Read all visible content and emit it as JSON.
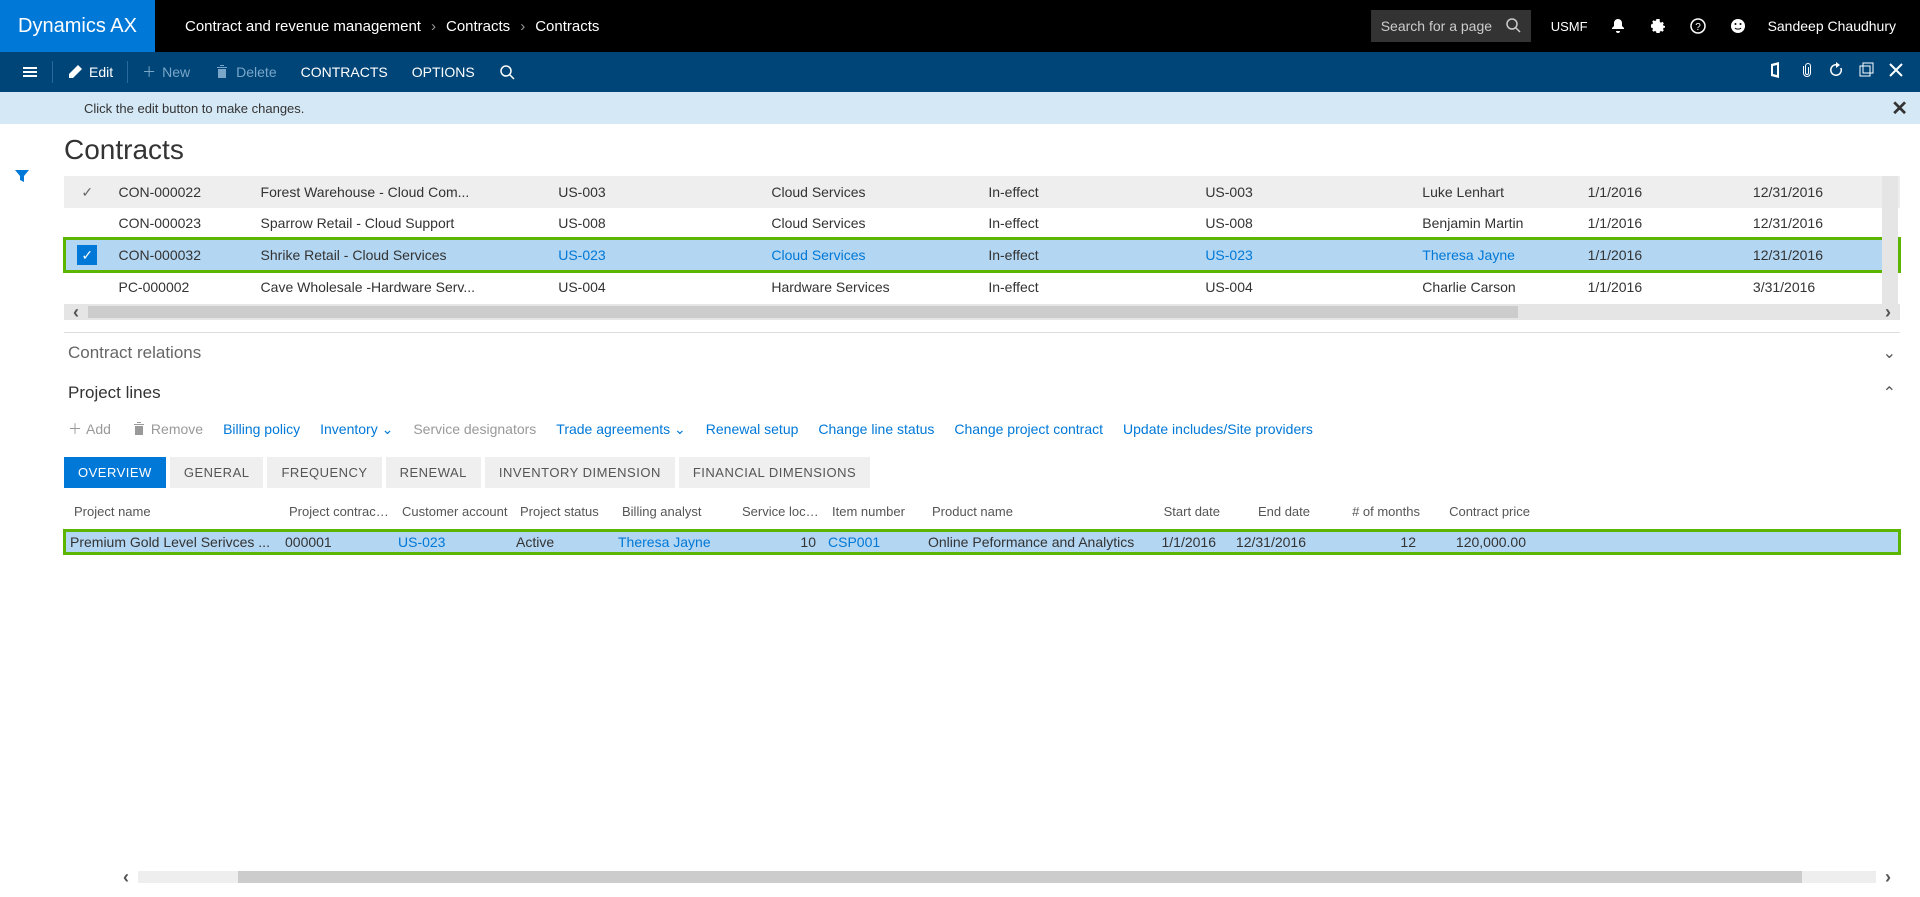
{
  "app": {
    "logo": "Dynamics AX"
  },
  "breadcrumb": [
    "Contract and revenue management",
    "Contracts",
    "Contracts"
  ],
  "search": {
    "placeholder": "Search for a page"
  },
  "company": "USMF",
  "user": "Sandeep Chaudhury",
  "toolbar": {
    "edit": "Edit",
    "new": "New",
    "delete": "Delete",
    "contracts": "CONTRACTS",
    "options": "OPTIONS"
  },
  "info": "Click the edit button to make changes.",
  "page_title": "Contracts",
  "grid": {
    "rows": [
      {
        "id": "CON-000022",
        "name": "Forest Warehouse - Cloud Com...",
        "account": "US-003",
        "service": "Cloud Services",
        "status": "In-effect",
        "loc": "US-003",
        "owner": "Luke Lenhart",
        "start": "1/1/2016",
        "end": "12/31/2016",
        "header": true
      },
      {
        "id": "CON-000023",
        "name": "Sparrow Retail - Cloud Support",
        "account": "US-008",
        "service": "Cloud Services",
        "status": "In-effect",
        "loc": "US-008",
        "owner": "Benjamin Martin",
        "start": "1/1/2016",
        "end": "12/31/2016"
      },
      {
        "id": "CON-000032",
        "name": "Shrike Retail - Cloud Services",
        "account": "US-023",
        "service": "Cloud Services",
        "status": "In-effect",
        "loc": "US-023",
        "owner": "Theresa Jayne",
        "start": "1/1/2016",
        "end": "12/31/2016",
        "selected": true,
        "highlight": true
      },
      {
        "id": "PC-000002",
        "name": "Cave Wholesale -Hardware Serv...",
        "account": "US-004",
        "service": "Hardware Services",
        "status": "In-effect",
        "loc": "US-004",
        "owner": "Charlie Carson",
        "start": "1/1/2016",
        "end": "3/31/2016"
      }
    ]
  },
  "sections": {
    "relations": "Contract relations",
    "lines": "Project lines"
  },
  "line_toolbar": {
    "add": "Add",
    "remove": "Remove",
    "billing_policy": "Billing policy",
    "inventory": "Inventory",
    "service_designators": "Service designators",
    "trade_agreements": "Trade agreements",
    "renewal_setup": "Renewal setup",
    "change_line_status": "Change line status",
    "change_project_contract": "Change project contract",
    "update_includes": "Update includes/Site providers"
  },
  "tabs": [
    "OVERVIEW",
    "GENERAL",
    "FREQUENCY",
    "RENEWAL",
    "INVENTORY DIMENSION",
    "FINANCIAL DIMENSIONS"
  ],
  "lines_cols": {
    "project_name": "Project name",
    "project_contract_id": "Project contract ID",
    "customer_account": "Customer account",
    "project_status": "Project status",
    "billing_analyst": "Billing analyst",
    "service_location": "Service locati...",
    "item_number": "Item number",
    "product_name": "Product name",
    "start_date": "Start date",
    "end_date": "End date",
    "months": "# of months",
    "contract_price": "Contract price"
  },
  "lines_row": {
    "project_name": "Premium Gold Level Serivces ...",
    "project_contract_id": "000001",
    "customer_account": "US-023",
    "project_status": "Active",
    "billing_analyst": "Theresa Jayne",
    "service_location": "10",
    "item_number": "CSP001",
    "product_name": "Online Peformance and Analytics",
    "start_date": "1/1/2016",
    "end_date": "12/31/2016",
    "months": "12",
    "contract_price": "120,000.00"
  }
}
